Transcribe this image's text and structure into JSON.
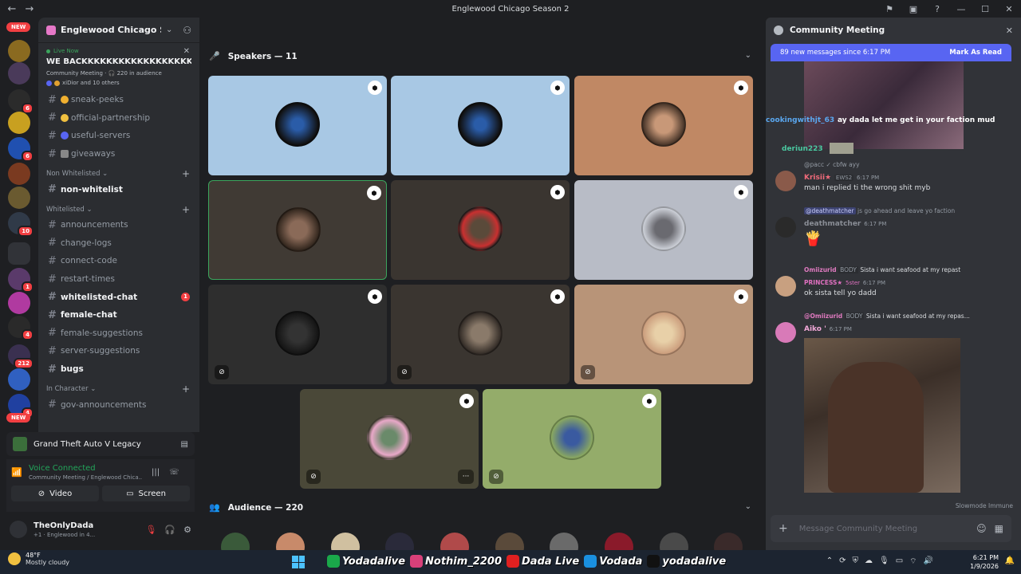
{
  "window": {
    "title": "Englewood Chicago Season 2"
  },
  "server_rail": {
    "badges": [
      "NEW",
      "6",
      "6",
      "10",
      "1",
      "4",
      "212",
      "4",
      "NEW"
    ]
  },
  "sidebar": {
    "guild_name": "Englewood Chicago Sea...",
    "live": {
      "label": "Live Now",
      "title": "WE BACKKKKKKKKKKKKKKKKKKKK",
      "subtitle": "Community Meeting · 🎧 220 in audience",
      "people": "xiDior and 10 others"
    },
    "channels_top": [
      {
        "name": "sneak-peeks",
        "bold": false
      },
      {
        "name": "official-partnership",
        "bold": false
      },
      {
        "name": "useful-servers",
        "bold": false
      },
      {
        "name": "giveaways",
        "bold": false
      }
    ],
    "categories": {
      "non_whitelisted": "Non Whitelisted",
      "whitelisted": "Whitelisted",
      "in_character": "In Character"
    },
    "channels_nonwl": [
      {
        "name": "non-whitelist"
      }
    ],
    "channels_wl": [
      {
        "name": "announcements"
      },
      {
        "name": "change-logs"
      },
      {
        "name": "connect-code"
      },
      {
        "name": "restart-times"
      },
      {
        "name": "whitelisted-chat",
        "badge": "1"
      },
      {
        "name": "female-chat"
      },
      {
        "name": "female-suggestions"
      },
      {
        "name": "server-suggestions"
      },
      {
        "name": "bugs"
      }
    ],
    "channels_ic": [
      {
        "name": "gov-announcements"
      }
    ]
  },
  "activity": {
    "game": "Grand Theft Auto V Legacy"
  },
  "voice": {
    "status": "Voice Connected",
    "location": "Community Meeting / Englewood Chica...",
    "video_label": "Video",
    "screen_label": "Screen"
  },
  "user": {
    "name": "TheOnlyDada",
    "status": "+1 · Englewood in 4..."
  },
  "stage": {
    "speakers_label": "Speakers — 11",
    "audience_label": "Audience — 220"
  },
  "chat": {
    "title": "Community Meeting",
    "new_messages": "89 new messages since 6:17 PM",
    "mark_read": "Mark As Read",
    "messages": {
      "m1_author": "cookingwithjt_63",
      "m1_text": "ay dada let me get in your faction mud",
      "m2_author": "deriun223",
      "m3_reply": "@pacc  ✓ cbfw  ayy",
      "m3_author": "Krisii★",
      "m3_tag": "EWS2",
      "m3_time": "6:17 PM",
      "m3_text": "man i replied ti the wrong shit myb",
      "m4_reply_user": "@deathmatcher",
      "m4_reply": "js go ahead and leave yo faction",
      "m4_author": "deathmatcher",
      "m4_time": "6:17 PM",
      "m5_reply_user": "Omiizurid",
      "m5_reply_tag": "BODY",
      "m5_reply": "Sista i want seafood at my repast",
      "m5_author": "PRINCESS★",
      "m5_tag": "5ster",
      "m5_time": "6:17 PM",
      "m5_text": "ok sista tell yo dadd",
      "m6_reply_user": "@Omiizurid",
      "m6_reply_tag": "BODY",
      "m6_reply": "Sista i want seafood at my repas...",
      "m6_author": "Aiko '",
      "m6_time": "6:17 PM"
    },
    "slowmode": "Slowmode Immune",
    "placeholder": "Message Community Meeting"
  },
  "taskbar": {
    "temp": "48°F",
    "weather": "Mostly cloudy",
    "socials": [
      "Yodadalive",
      "Nothim_2200",
      "Dada Live",
      "Vodada",
      "yodadalive"
    ],
    "time": "6:21 PM",
    "date": "1/9/2026"
  }
}
